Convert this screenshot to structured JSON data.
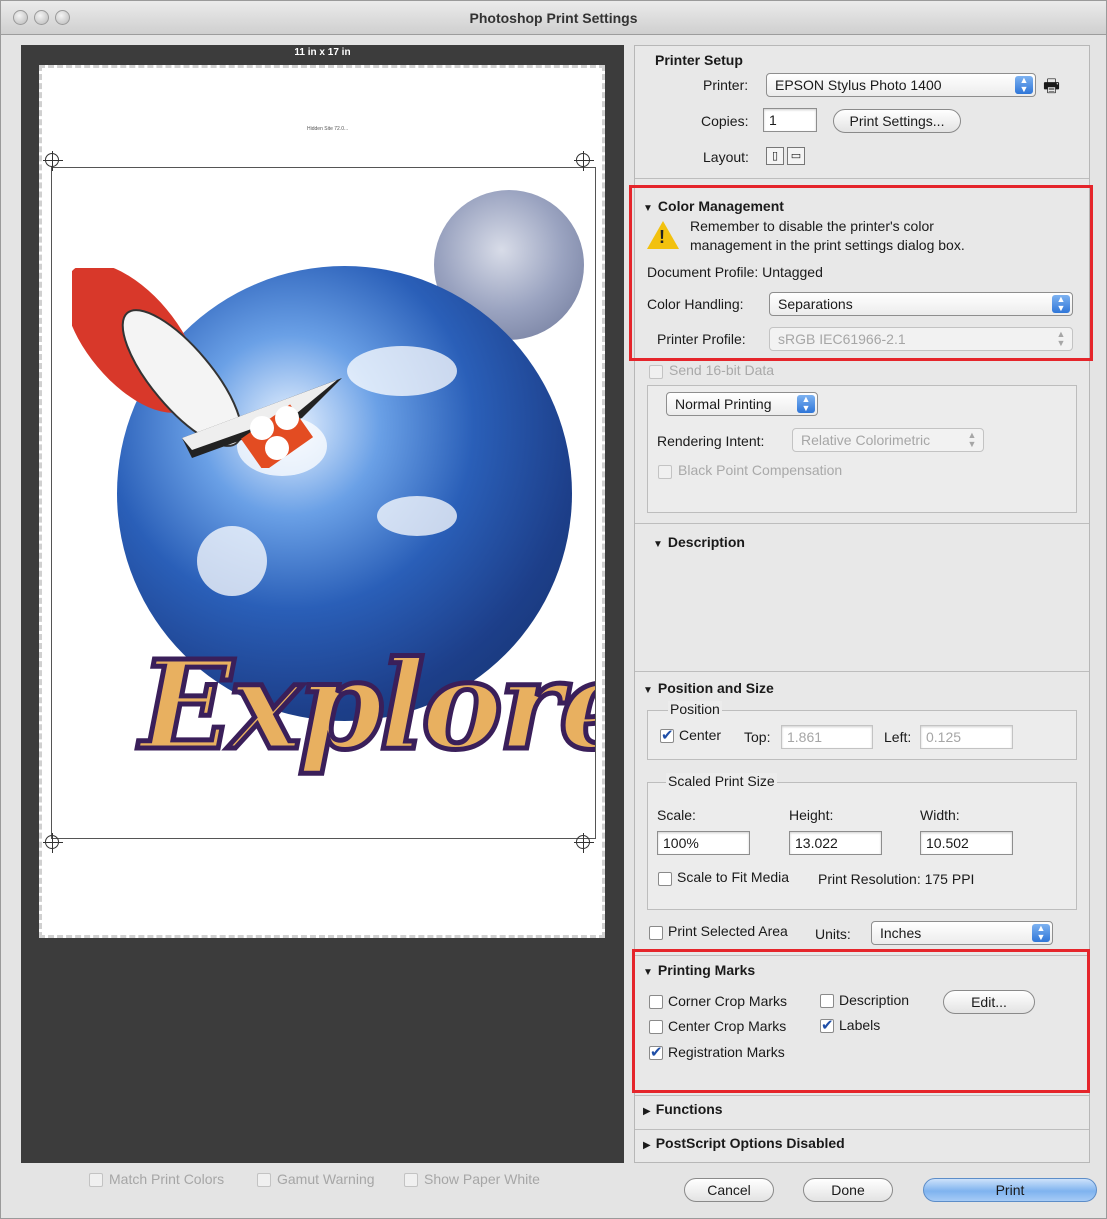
{
  "window": {
    "title": "Photoshop Print Settings"
  },
  "preview": {
    "paper_size": "11 in x 17 in",
    "tiny_label": "Hidden Site 72.0...",
    "artwork_text": "Explore"
  },
  "bottom_options": [
    {
      "label": "Match Print Colors",
      "checked": false
    },
    {
      "label": "Gamut Warning",
      "checked": false
    },
    {
      "label": "Show Paper White",
      "checked": false
    }
  ],
  "printer_setup": {
    "title": "Printer Setup",
    "printer_label": "Printer:",
    "printer_value": "EPSON Stylus Photo 1400",
    "copies_label": "Copies:",
    "copies_value": "1",
    "print_settings_button": "Print Settings...",
    "layout_label": "Layout:"
  },
  "color_management": {
    "title": "Color Management",
    "warning": "Remember to disable the printer's color management in the print settings dialog box.",
    "warning_line1": "Remember to disable the printer's color",
    "warning_line2": "management in the print settings dialog box.",
    "document_profile": "Document Profile: Untagged",
    "color_handling_label": "Color Handling:",
    "color_handling_value": "Separations",
    "printer_profile_label": "Printer Profile:",
    "printer_profile_value": "sRGB IEC61966-2.1",
    "send_16bit": "Send 16-bit Data",
    "normal_printing": "Normal Printing",
    "rendering_intent_label": "Rendering Intent:",
    "rendering_intent_value": "Relative Colorimetric",
    "black_point": "Black Point Compensation"
  },
  "description": {
    "title": "Description"
  },
  "position_size": {
    "title": "Position and Size",
    "position_group": "Position",
    "center_label": "Center",
    "center_checked": true,
    "top_label": "Top:",
    "top_value": "1.861",
    "left_label": "Left:",
    "left_value": "0.125",
    "scaled_group": "Scaled Print Size",
    "scale_label": "Scale:",
    "scale_value": "100%",
    "height_label": "Height:",
    "height_value": "13.022",
    "width_label": "Width:",
    "width_value": "10.502",
    "scale_to_fit": "Scale to Fit Media",
    "print_resolution": "Print Resolution: 175 PPI",
    "print_selected": "Print Selected Area",
    "units_label": "Units:",
    "units_value": "Inches"
  },
  "printing_marks": {
    "title": "Printing Marks",
    "corner_crop": "Corner Crop Marks",
    "center_crop": "Center Crop Marks",
    "registration": "Registration Marks",
    "description": "Description",
    "labels": "Labels",
    "edit_button": "Edit..."
  },
  "functions": {
    "title": "Functions"
  },
  "postscript": {
    "title": "PostScript Options Disabled"
  },
  "buttons": {
    "cancel": "Cancel",
    "done": "Done",
    "print": "Print"
  },
  "colors": {
    "highlight": "#e5252b",
    "accent": "#2f76d8"
  }
}
